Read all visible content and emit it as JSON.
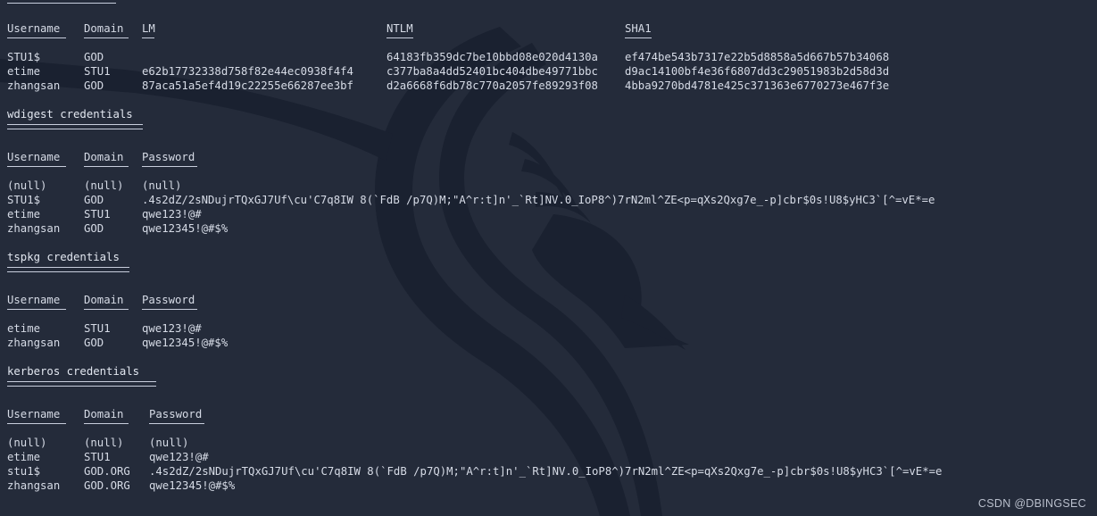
{
  "terminal": {
    "watermark": "CSDN @DBINGSEC",
    "background_color": "#242b3a",
    "text_color": "#d6dbe6",
    "dragon_color": "#1b2231"
  },
  "hash_table": {
    "headers": {
      "username": "Username",
      "domain": "Domain",
      "lm": "LM",
      "ntlm": "NTLM",
      "sha1": "SHA1"
    },
    "lm_underline": "--",
    "rows": [
      {
        "username": "STU1$",
        "domain": "GOD",
        "lm": "",
        "ntlm": "64183fb359dc7be10bbd08e020d4130a",
        "sha1": "ef474be543b7317e22b5d8858a5d667b57b34068"
      },
      {
        "username": "etime",
        "domain": "STU1",
        "lm": "e62b17732338d758f82e44ec0938f4f4",
        "ntlm": "c377ba8a4dd52401bc404dbe49771bbc",
        "sha1": "d9ac14100bf4e36f6807dd3c29051983b2d58d3d"
      },
      {
        "username": "zhangsan",
        "domain": "GOD",
        "lm": "87aca51a5ef4d19c22255e66287ee3bf",
        "ntlm": "d2a6668f6db78c770a2057fe89293f08",
        "sha1": "4bba9270bd4781e425c371363e6770273e467f3e"
      }
    ]
  },
  "wdigest": {
    "title": "wdigest credentials",
    "headers": {
      "username": "Username",
      "domain": "Domain",
      "password": "Password"
    },
    "rows": [
      {
        "username": "(null)",
        "domain": "(null)",
        "password": "(null)"
      },
      {
        "username": "STU1$",
        "domain": "GOD",
        "password": ".4s2dZ/2sNDujrTQxGJ7Uf\\cu'C7q8IW 8(`FdB /p7Q)M;\"A^r:t]n'_`Rt]NV.0_IoP8^)7rN2ml^ZE<p=qXs2Qxg7e_-p]cbr$0s!U8$yHC3`[^=vE*=e"
      },
      {
        "username": "etime",
        "domain": "STU1",
        "password": "qwe123!@#"
      },
      {
        "username": "zhangsan",
        "domain": "GOD",
        "password": "qwe12345!@#$%"
      }
    ]
  },
  "tspkg": {
    "title": "tspkg credentials",
    "headers": {
      "username": "Username",
      "domain": "Domain",
      "password": "Password"
    },
    "rows": [
      {
        "username": "etime",
        "domain": "STU1",
        "password": "qwe123!@#"
      },
      {
        "username": "zhangsan",
        "domain": "GOD",
        "password": "qwe12345!@#$%"
      }
    ]
  },
  "kerberos": {
    "title": "kerberos credentials",
    "headers": {
      "username": "Username",
      "domain": "Domain",
      "password": "Password"
    },
    "rows": [
      {
        "username": "(null)",
        "domain": "(null)",
        "password": "(null)"
      },
      {
        "username": "etime",
        "domain": "STU1",
        "password": "qwe123!@#"
      },
      {
        "username": "stu1$",
        "domain": "GOD.ORG",
        "password": ".4s2dZ/2sNDujrTQxGJ7Uf\\cu'C7q8IW 8(`FdB /p7Q)M;\"A^r:t]n'_`Rt]NV.0_IoP8^)7rN2ml^ZE<p=qXs2Qxg7e_-p]cbr$0s!U8$yHC3`[^=vE*=e"
      },
      {
        "username": "zhangsan",
        "domain": "GOD.ORG",
        "password": "qwe12345!@#$%"
      }
    ]
  }
}
